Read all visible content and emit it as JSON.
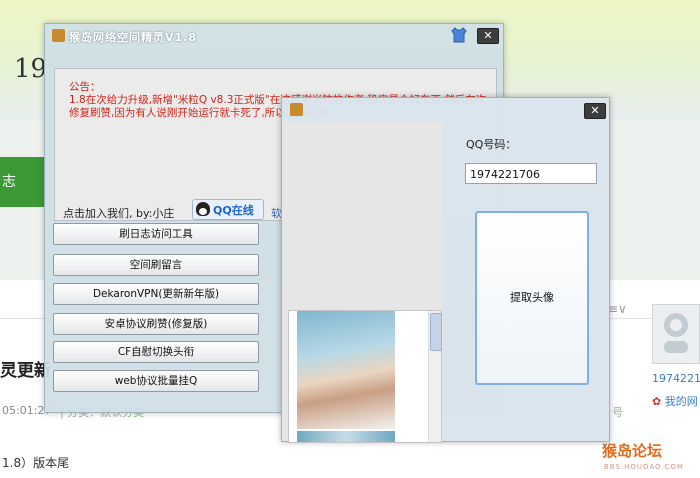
{
  "background": {
    "year": "19",
    "green_tab": "志",
    "bold_heading": "灵更新",
    "time": "05:01:27",
    "time_tail": "| 分类：默认分类",
    "version_line": "1.8）版本尾",
    "user_id": "1974221",
    "my_link": "我的网",
    "edge_text": "≡∨",
    "edge_num": "号",
    "logo": "猴岛论坛",
    "logo_sub": "BBS.HOUDAO.COM"
  },
  "main_window": {
    "title": "猴岛网络空间精灵V1.8",
    "close_symbol": "✕",
    "notice": "公告：\n1.8在次给力升级,新增\"米粒Q v8.3正式版\"在这感谢米粒的作者,确实是个好东西,然后在次修复刷赞,因为有人说刚开始运行就卡死了,所以拿来看看,",
    "join_text": "点击加入我们, by:小庄",
    "qq_online": "QQ在线",
    "soft_text": "软件",
    "buttons": [
      "刷日志访问工具",
      "空间刷留言",
      "DekaronVPN(更新新年版)",
      "安卓协议刷赞(修复版)",
      "CF自慰切换头衔",
      "web协议批量挂Q"
    ]
  },
  "fetch_window": {
    "close_symbol": "✕",
    "qq_label": "QQ号码：",
    "qq_value": "1974221706",
    "fetch_button": "提取头像"
  }
}
